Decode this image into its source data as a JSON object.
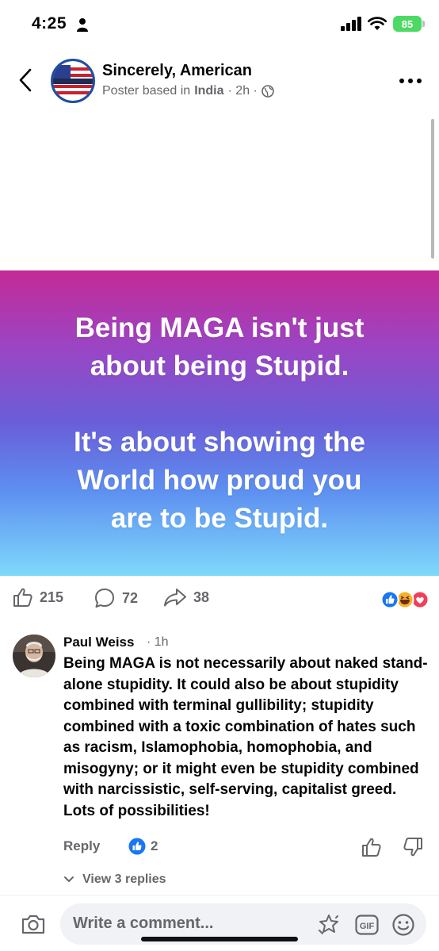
{
  "status_bar": {
    "time": "4:25",
    "battery": "85",
    "icons": [
      "person-icon",
      "signal-icon",
      "wifi-icon",
      "battery-icon"
    ]
  },
  "header": {
    "page_name": "Sincerely, American",
    "poster_prefix": "Poster based in",
    "poster_country": "India",
    "time": "· 2h ·",
    "avatar_text": "Sincerely, American",
    "icons": [
      "back-icon",
      "globe-icon",
      "more-icon"
    ]
  },
  "post": {
    "lines_a": [
      "Being MAGA isn't just",
      "about being Stupid."
    ],
    "lines_b": [
      "It's about showing the",
      "World how proud you",
      "are to be Stupid."
    ],
    "colors": {
      "gradient_top": "#c42a96",
      "gradient_mid": "#6a5ed8",
      "gradient_bottom": "#7fd9fb"
    }
  },
  "actions": {
    "likes": "215",
    "comments": "72",
    "shares": "38",
    "reactions": [
      "like-reaction",
      "haha-reaction",
      "love-reaction"
    ]
  },
  "comment": {
    "author": "Paul Weiss",
    "time": "· 1h",
    "text": "Being MAGA is not necessarily about naked stand-alone stupidity. It could also be about stupidity combined with terminal gullibility; stupidity combined with a toxic combination of hates such as racism, Islamophobia, homophobia, and misogyny; or it might even be stupidity combined with narcissistic, self-serving, capitalist greed. Lots of possibilities!",
    "reply_label": "Reply",
    "like_count": "2",
    "view_replies": "View 3 replies"
  },
  "composer": {
    "placeholder": "Write a comment...",
    "gif_label": "GIF"
  },
  "colors": {
    "accent": "#1877f2",
    "muted": "#65676b",
    "battery": "#4cd964"
  }
}
